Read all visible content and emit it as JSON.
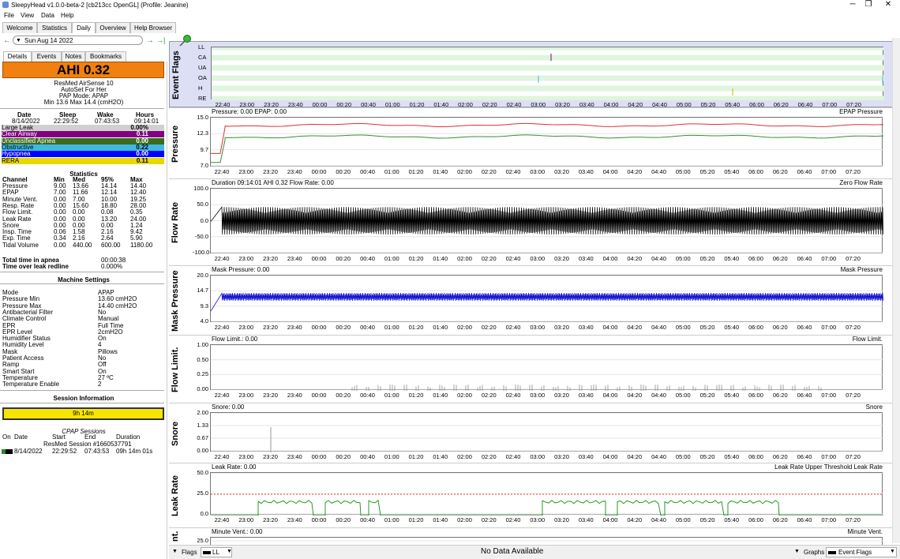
{
  "window": {
    "title": "SleepyHead v1.0.0-beta-2 [cb213cc OpenGL] (Profile: Jeanine)",
    "minimize": "─",
    "maximize": "❐",
    "close": "✕"
  },
  "menu": [
    "File",
    "View",
    "Data",
    "Help"
  ],
  "tabs": [
    "Welcome",
    "Statistics",
    "Daily",
    "Overview",
    "Help Browser"
  ],
  "date": {
    "value": "Sun Aug 14 2022",
    "prev": "←",
    "next": "→",
    "last": "→|"
  },
  "subtabs": [
    "Details",
    "Events",
    "Notes",
    "Bookmarks"
  ],
  "ahi": {
    "text": "AHI 0.32"
  },
  "machine": {
    "model": "ResMed AirSense 10",
    "mode_name": "AutoSet For Her",
    "pap_mode": "PAP Mode: APAP",
    "pressure_range": "Min 13.6 Max 14.4 (cmH2O)"
  },
  "summary": {
    "headers": [
      "Date",
      "Sleep",
      "Wake",
      "Hours"
    ],
    "values": [
      "8/14/2022",
      "22:29:52",
      "07:43:53",
      "09:14:01"
    ]
  },
  "events": [
    {
      "name": "Large Leak",
      "value": "0.00%",
      "bg": "#d0d0d0",
      "fg": "#000"
    },
    {
      "name": "Clear Airway",
      "value": "0.11",
      "bg": "#800080",
      "fg": "#fff"
    },
    {
      "name": "Unclassified Apnea",
      "value": "0.00",
      "bg": "#3a6b1e",
      "fg": "#fff"
    },
    {
      "name": "Obstructive",
      "value": "0.22",
      "bg": "#40b8e0",
      "fg": "#000"
    },
    {
      "name": "Hypopnea",
      "value": "0.00",
      "bg": "#0000ff",
      "fg": "#fff"
    },
    {
      "name": "RERA",
      "value": "0.11",
      "bg": "#e8d800",
      "fg": "#000"
    }
  ],
  "statistics": {
    "title": "Statistics",
    "headers": [
      "Channel",
      "Min",
      "Med",
      "95%",
      "Max"
    ],
    "rows": [
      [
        "Pressure",
        "9.00",
        "13.66",
        "14.14",
        "14.40"
      ],
      [
        "EPAP",
        "7.00",
        "11.66",
        "12.14",
        "12.40"
      ],
      [
        "Minute Vent.",
        "0.00",
        "7.00",
        "10.00",
        "19.25"
      ],
      [
        "Resp. Rate",
        "0.00",
        "15.60",
        "18.80",
        "28.00"
      ],
      [
        "Flow Limit.",
        "0.00",
        "0.00",
        "0.08",
        "0.35"
      ],
      [
        "Leak Rate",
        "0.00",
        "0.00",
        "13.20",
        "24.00"
      ],
      [
        "Snore",
        "0.00",
        "0.00",
        "0.00",
        "1.24"
      ],
      [
        "Insp. Time",
        "0.06",
        "1.58",
        "2.16",
        "9.42"
      ],
      [
        "Exp. Time",
        "0.34",
        "2.16",
        "2.64",
        "5.90"
      ],
      [
        "Tidal Volume",
        "0.00",
        "440.00",
        "600.00",
        "1180.00"
      ]
    ]
  },
  "apnea": {
    "total_label": "Total time in apnea",
    "total_value": "00:00:38",
    "redline_label": "Time over leak redline",
    "redline_value": "0.000%"
  },
  "settings": {
    "title": "Machine Settings",
    "rows": [
      [
        "Mode",
        "APAP"
      ],
      [
        "Pressure Min",
        "13.60 cmH2O"
      ],
      [
        "Pressure Max",
        "14.40 cmH2O"
      ],
      [
        "Antibacterial Filter",
        "No"
      ],
      [
        "Climate Control",
        "Manual"
      ],
      [
        "EPR",
        "Full Time"
      ],
      [
        "EPR Level",
        "2cmH2O"
      ],
      [
        "Humidifier Status",
        "On"
      ],
      [
        "Humidity Level",
        "4"
      ],
      [
        "Mask",
        "Pillows"
      ],
      [
        "Patient Access",
        "No"
      ],
      [
        "Ramp",
        "Off"
      ],
      [
        "Smart Start",
        "On"
      ],
      [
        "Temperature",
        "27 ºC"
      ],
      [
        "Temperature Enable",
        "2"
      ]
    ]
  },
  "session": {
    "title": "Session Information",
    "bar": "9h 14m",
    "cpap_title": "CPAP Sessions",
    "headers": [
      "On",
      "Date",
      "Start",
      "End",
      "Duration"
    ],
    "session_name": "ResMed Session #1660537791",
    "row": [
      "8/14/2022",
      "22:29:52",
      "07:43:53",
      "09h 14m 01s"
    ]
  },
  "xticks": [
    "22:40",
    "23:00",
    "23:20",
    "23:40",
    "00:00",
    "00:20",
    "00:40",
    "01:00",
    "01:20",
    "01:40",
    "02:00",
    "02:20",
    "02:40",
    "03:00",
    "03:20",
    "03:40",
    "04:00",
    "04:20",
    "04:40",
    "05:00",
    "05:20",
    "05:40",
    "06:00",
    "06:20",
    "06:40",
    "07:00",
    "07:20"
  ],
  "graphs": [
    {
      "id": "flags",
      "label": "Event Flags",
      "title": "",
      "legend": "",
      "yticks": [
        "LL",
        "CA",
        "UA",
        "OA",
        "H",
        "RE"
      ]
    },
    {
      "id": "pressure",
      "label": "Pressure",
      "title": "Pressure: 0.00 EPAP: 0.00",
      "legend": "EPAP  Pressure",
      "yticks": [
        "15.0",
        "12.3",
        "9.7",
        "7.0"
      ]
    },
    {
      "id": "flow",
      "label": "Flow Rate",
      "title": "Duration 09:14:01 AHI 0.32 Flow Rate: 0.00",
      "legend": "Zero  Flow Rate",
      "yticks": [
        "100.0",
        "50.0",
        "0.0",
        "-50.0",
        "-100.0"
      ]
    },
    {
      "id": "mask",
      "label": "Mask Pressure",
      "title": "Mask Pressure: 0.00",
      "legend": "Mask Pressure",
      "yticks": [
        "20.0",
        "14.7",
        "9.3",
        "4.0"
      ]
    },
    {
      "id": "flowlimit",
      "label": "Flow Limit.",
      "title": "Flow Limit.: 0.00",
      "legend": "Flow Limit.",
      "yticks": [
        "1.00",
        "0.50",
        "0.25",
        "0.00"
      ]
    },
    {
      "id": "snore",
      "label": "Snore",
      "title": "Snore: 0.00",
      "legend": "Snore",
      "yticks": [
        "2.00",
        "1.33",
        "0.67",
        "0.00"
      ]
    },
    {
      "id": "leak",
      "label": "Leak Rate",
      "title": "Leak Rate: 0.00",
      "legend": "Leak Rate Upper Threshold  Leak Rate",
      "yticks": [
        "50.0",
        "25.0",
        "0.0"
      ]
    },
    {
      "id": "minvent",
      "label": "nt.",
      "title": "Minute Vent.: 0.00",
      "legend": "Minute Vent.",
      "yticks": [
        "25.0"
      ]
    }
  ],
  "bottombar": {
    "flags_label": "Flags",
    "flags_value": "LL",
    "status": "No Data Available",
    "graphs_label": "Graphs",
    "graphs_value": "Event Flags"
  },
  "colors": {
    "pressure": "#e03030",
    "epap": "#309030",
    "flow": "#000000",
    "mask": "#1010d0",
    "leak": "#109010",
    "threshold": "#e04040",
    "flowlimit": "#909090"
  }
}
